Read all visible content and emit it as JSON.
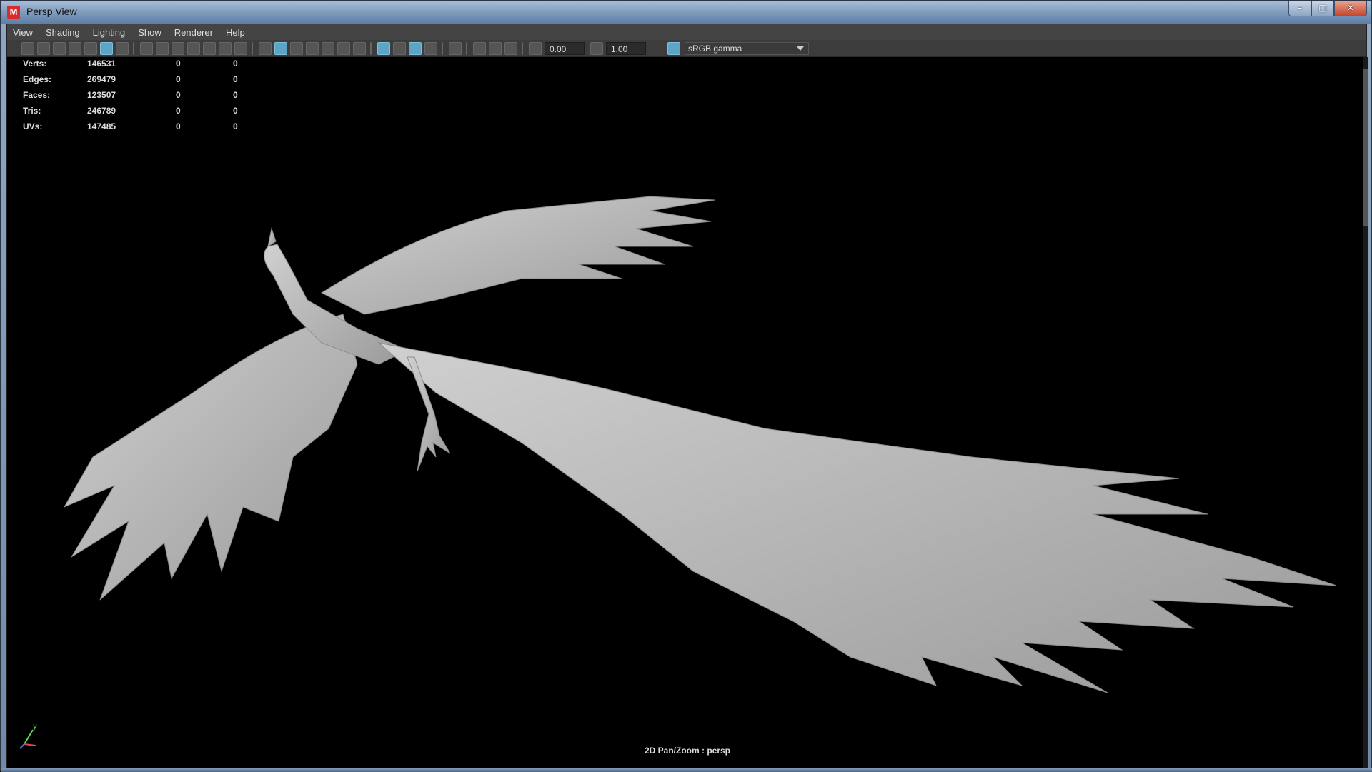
{
  "window": {
    "title": "Persp View",
    "app_icon_letter": "M",
    "controls": [
      "minimize",
      "maximize",
      "close"
    ]
  },
  "menubar": {
    "items": [
      "View",
      "Shading",
      "Lighting",
      "Show",
      "Renderer",
      "Help"
    ]
  },
  "toolbar": {
    "exposure_value": "0.00",
    "gamma_value": "1.00",
    "color_space": "sRGB gamma"
  },
  "hud": {
    "rows": [
      {
        "label": "Verts:",
        "v1": "146531",
        "v2": "0",
        "v3": "0"
      },
      {
        "label": "Edges:",
        "v1": "269479",
        "v2": "0",
        "v3": "0"
      },
      {
        "label": "Faces:",
        "v1": "123507",
        "v2": "0",
        "v3": "0"
      },
      {
        "label": "Tris:",
        "v1": "246789",
        "v2": "0",
        "v3": "0"
      },
      {
        "label": "UVs:",
        "v1": "147485",
        "v2": "0",
        "v3": "0"
      }
    ]
  },
  "viewport": {
    "status": "2D Pan/Zoom : persp",
    "axis_label": "y"
  },
  "colors": {
    "model": "#bdbdbd",
    "viewport_bg": "#000000",
    "active_icon": "#5ea4c4"
  }
}
